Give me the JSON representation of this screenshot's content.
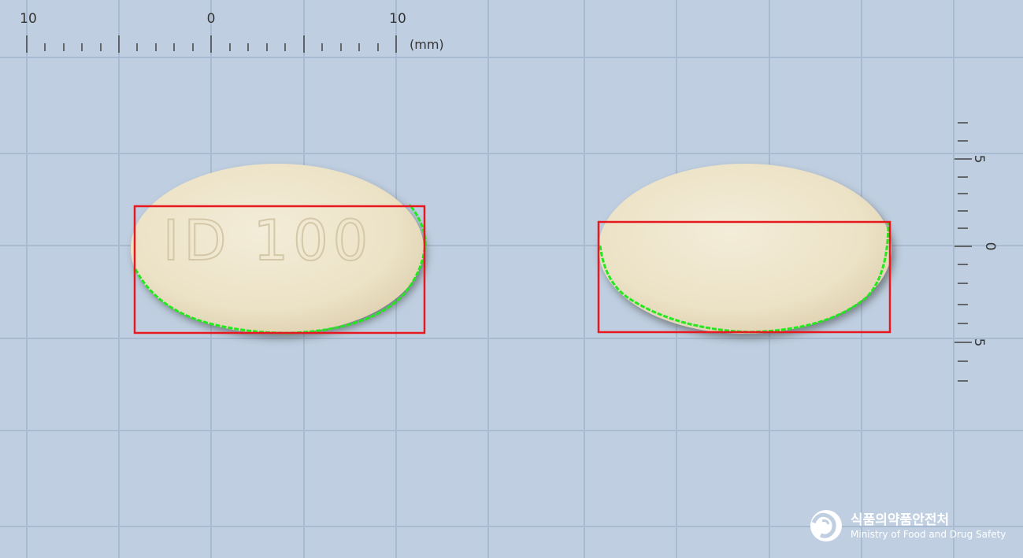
{
  "top_ruler": {
    "labels": [
      "10",
      "0",
      "10"
    ],
    "unit": "(mm)"
  },
  "right_ruler": {
    "labels": [
      "5",
      "0",
      "5"
    ]
  },
  "pill_front": {
    "imprint": "ID 100"
  },
  "logo": {
    "korean": "식품의약품안전처",
    "english": "Ministry of Food and Drug Safety"
  },
  "colors": {
    "background": "#bfcfe1",
    "grid_line": "#a9bbd1",
    "tablet": "#efe6cf",
    "bounding_box": "#e8181f",
    "contour": "#22e81e"
  }
}
